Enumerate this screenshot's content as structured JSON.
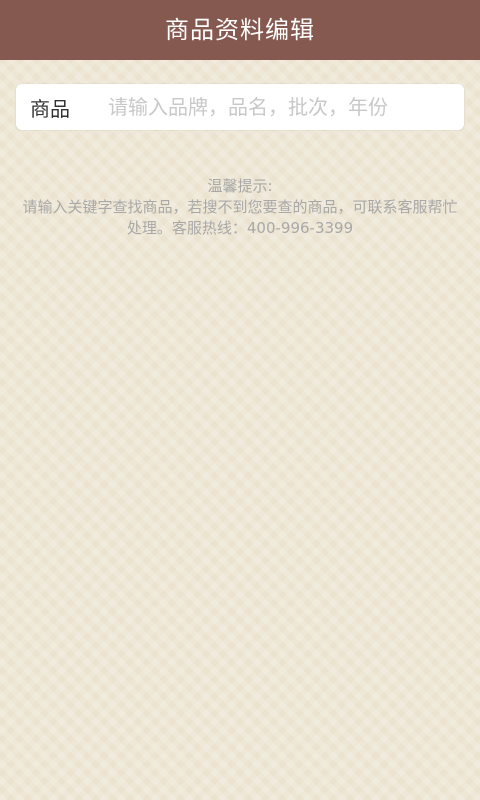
{
  "header": {
    "title": "商品资料编辑"
  },
  "search": {
    "label": "商品",
    "placeholder": "请输入品牌，品名，批次，年份",
    "value": ""
  },
  "hint": {
    "title": "温馨提示:",
    "body": "请输入关键字查找商品，若搜不到您要查的商品，可联系客服帮忙处理。客服热线：400-996-3399"
  },
  "colors": {
    "header_bg": "#85594f",
    "page_bg": "#ebe3cf",
    "hint_text": "#a8a8a8"
  }
}
